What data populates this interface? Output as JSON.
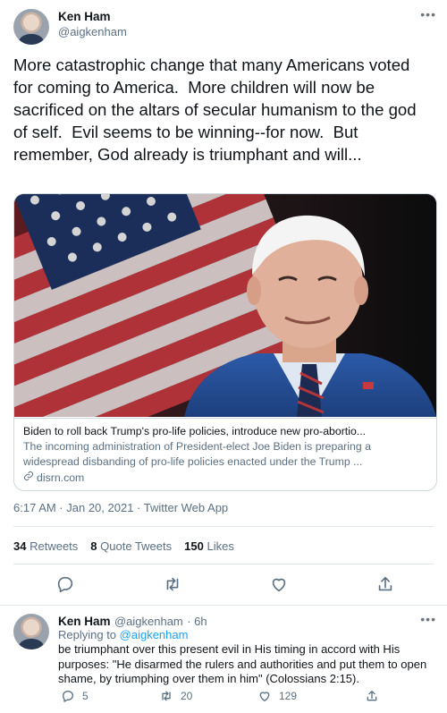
{
  "tweet": {
    "author_name": "Ken Ham",
    "author_handle": "@aigkenham",
    "text": "More catastrophic change that many Americans voted for coming to America.  More children will now be sacrificed on the altars of secular humanism to the god of self.  Evil seems to be winning--for now.  But remember, God already is triumphant and will...",
    "card": {
      "title": "Biden to roll back Trump's pro-life policies, introduce new pro-abortio...",
      "description": "The incoming administration of President-elect Joe Biden is preparing a widespread disbanding of pro-life policies enacted under the Trump ...",
      "domain": "disrn.com"
    },
    "timestamp": "6:17 AM · Jan 20, 2021 · Twitter Web App",
    "stats": {
      "retweets_count": "34",
      "retweets_label": "Retweets",
      "quote_count": "8",
      "quote_label": "Quote Tweets",
      "likes_count": "150",
      "likes_label": "Likes"
    },
    "icons": [
      "more-icon",
      "reply-icon",
      "retweet-icon",
      "like-icon",
      "share-icon",
      "link-icon"
    ]
  },
  "reply": {
    "author_name": "Ken Ham",
    "author_handle": "@aigkenham",
    "time": "· 6h",
    "replying_prefix": "Replying to ",
    "replying_handle": "@aigkenham",
    "text": "be triumphant over this present evil in His timing in accord with His purposes:  \"He disarmed the rulers and authorities and put them to open shame, by triumphing over them in him\" (Colossians 2:15).",
    "reply_count": "5",
    "retweet_count": "20",
    "like_count": "129"
  },
  "colors": {
    "text": "#0f1419",
    "secondary": "#5b7083",
    "link": "#1da1f2",
    "border": "#cfd9de"
  }
}
